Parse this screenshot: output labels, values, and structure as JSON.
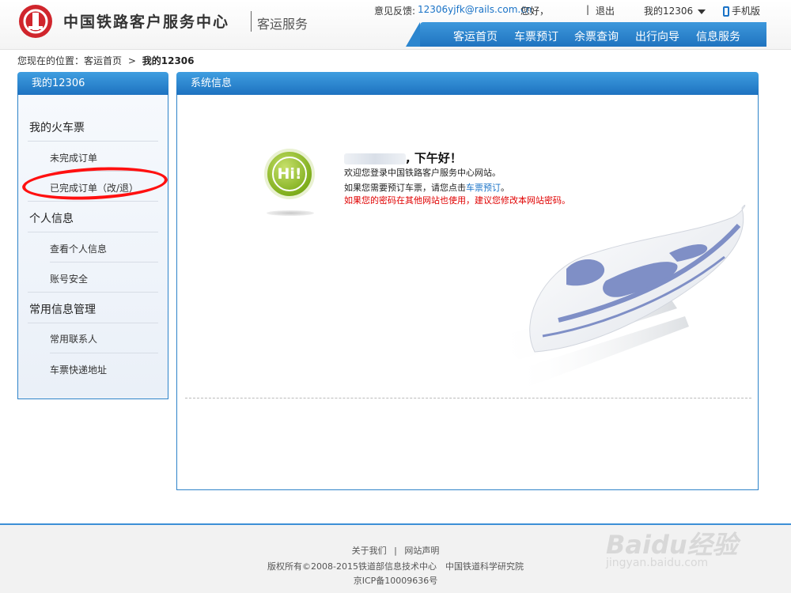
{
  "header": {
    "site_title": "中国铁路客户服务中心",
    "site_sub": "客运服务",
    "feedback_label": "意见反馈:",
    "feedback_email": "12306yjfk@rails.com.cn",
    "greeting": "您好，",
    "logout": "退出",
    "my12306": "我的12306",
    "mobile": "手机版"
  },
  "nav": {
    "items": [
      "客运首页",
      "车票预订",
      "余票查询",
      "出行向导",
      "信息服务"
    ]
  },
  "breadcrumb": {
    "prefix": "您现在的位置：",
    "home": "客运首页",
    "sep": ">",
    "current": "我的12306"
  },
  "sidebar": {
    "title": "我的12306",
    "sections": [
      {
        "title": "我的火车票",
        "items": [
          "未完成订单",
          "已完成订单（改/退）"
        ]
      },
      {
        "title": "个人信息",
        "items": [
          "查看个人信息",
          "账号安全"
        ]
      },
      {
        "title": "常用信息管理",
        "items": [
          "常用联系人",
          "车票快递地址"
        ]
      }
    ]
  },
  "main": {
    "title": "系统信息",
    "hi_text": "Hi!",
    "greet": ", 下午好！",
    "line1": "欢迎您登录中国铁路客户服务中心网站。",
    "line2_pre": "如果您需要预订车票，请您点击",
    "line2_link": "车票预订",
    "line2_post": "。",
    "line3": "如果您的密码在其他网站也使用，建议您修改本网站密码。"
  },
  "footer": {
    "about": "关于我们",
    "sep": "|",
    "statement": "网站声明",
    "copyright": "版权所有©2008-2015铁道部信息技术中心　中国铁道科学研究院",
    "icp": "京ICP备10009636号"
  },
  "watermark": {
    "brand": "Baidu经验",
    "url": "jingyan.baidu.com"
  },
  "colors": {
    "accent": "#1f73bf",
    "brand_red": "#d0252c",
    "warning": "#e00000",
    "hi_green": "#7fae1c"
  }
}
